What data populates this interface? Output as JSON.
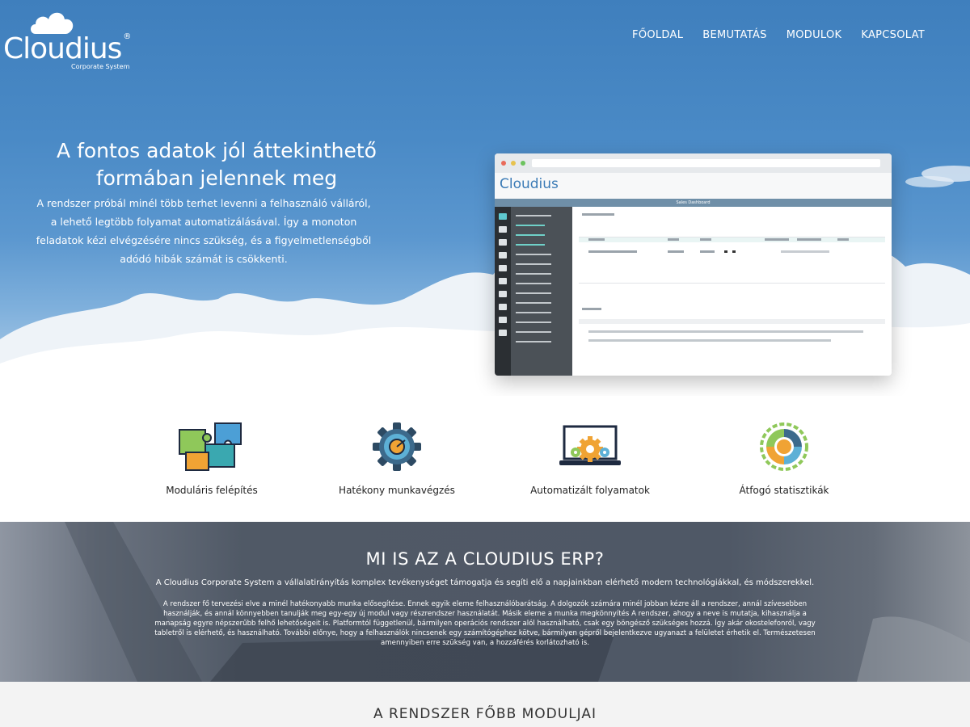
{
  "brand": {
    "name": "Cloudius",
    "reg": "®",
    "tagline": "Corporate System"
  },
  "nav": {
    "items": [
      {
        "label": "FŐOLDAL"
      },
      {
        "label": "BEMUTATÁS"
      },
      {
        "label": "MODULOK"
      },
      {
        "label": "KAPCSOLAT"
      }
    ]
  },
  "hero": {
    "title": "A fontos adatok jól áttekinthető formában jelennek meg",
    "text": "A rendszer próbál minél több terhet levenni a felhasználó válláról, a lehető legtöbb folyamat automatizálásával. Így a monoton feladatok kézi elvégzésére nincs szükség, és a figyelmetlenségből adódó hibák számát is csökkenti."
  },
  "mockup": {
    "logo": "Cloudius",
    "bar_title": "Sales Dashboard"
  },
  "features": [
    {
      "label": "Moduláris felépítés",
      "icon": "puzzle-icon"
    },
    {
      "label": "Hatékony munkavégzés",
      "icon": "gear-icon"
    },
    {
      "label": "Automatizált folyamatok",
      "icon": "laptop-gear-icon"
    },
    {
      "label": "Átfogó statisztikák",
      "icon": "donut-chart-icon"
    }
  ],
  "about": {
    "title": "MI IS AZ A CLOUDIUS ERP?",
    "lead": "A Cloudius Corporate System a vállalatirányítás komplex tevékenységet támogatja és segíti elő a napjainkban elérhető modern technológiákkal, és módszerekkel.",
    "text": "A rendszer fő tervezési elve a minél hatékonyabb munka elősegítése. Ennek egyik eleme felhasználóbarátság. A dolgozók számára minél jobban kézre áll a rendszer, annál szívesebben használják, és annál könnyebben tanulják meg egy-egy új modul vagy részrendszer használatát. Másik eleme a munka megkönnyítés A rendszer, ahogy a neve is mutatja, kihasználja a manapság egyre népszerűbb felhő lehetőségeit is. Platformtól függetlenül, bármilyen operációs rendszer alól használható, csak egy böngésző szükséges hozzá. Így akár okostelefonról, vagy tabletről is elérhető, és használható. További előnye, hogy a felhasználók nincsenek egy számítógéphez kötve, bármilyen gépről bejelentkezve ugyanazt a felületet érhetik el. Természetesen amennyiben erre szükség van, a hozzáférés korlátozható is."
  },
  "modules": {
    "title": "A RENDSZER FŐBB MODULJAI"
  }
}
